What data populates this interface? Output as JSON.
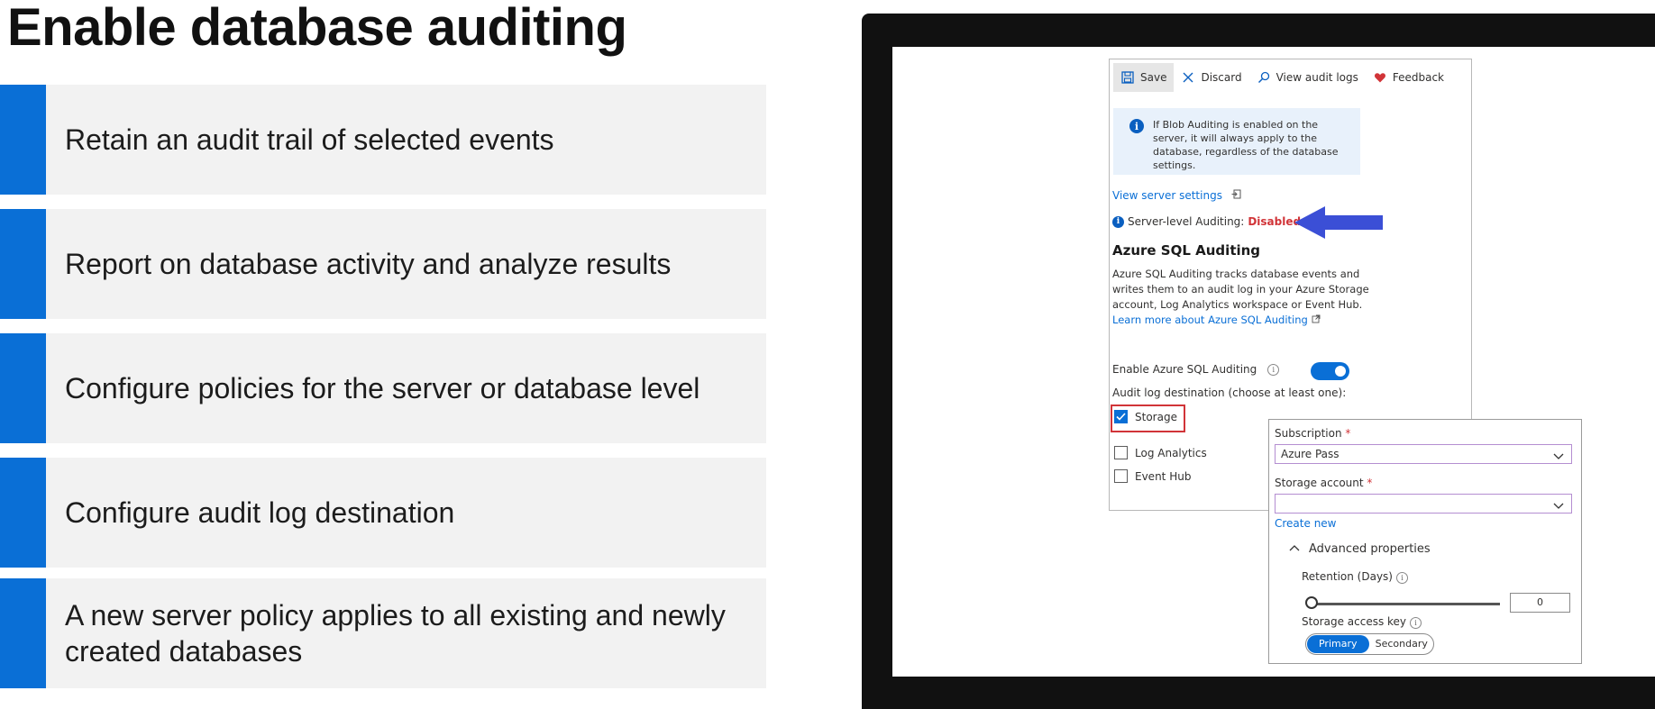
{
  "slide": {
    "title": "Enable database auditing",
    "bullets": [
      "Retain an audit trail of selected events",
      "Report on database activity and analyze results",
      "Configure policies for the server or database level",
      "Configure audit log destination",
      "A new server policy applies to all existing and newly created databases"
    ],
    "accent_color": "#0a6fd6"
  },
  "portal": {
    "toolbar": {
      "save": "Save",
      "discard": "Discard",
      "view_audit_logs": "View audit logs",
      "feedback": "Feedback"
    },
    "info_message": "If Blob Auditing is enabled on the server, it will always apply to the database, regardless of the database settings.",
    "view_server_settings": "View server settings",
    "server_level_label": "Server-level Auditing:",
    "server_level_status": "Disabled",
    "section_title": "Azure SQL Auditing",
    "description": "Azure SQL Auditing tracks database events and writes them to an audit log in your Azure Storage account, Log Analytics workspace or Event Hub.",
    "learn_more": "Learn more about Azure SQL Auditing",
    "enable_label": "Enable Azure SQL Auditing",
    "enable_on": true,
    "destination_label": "Audit log destination (choose at least one):",
    "destinations": [
      {
        "label": "Storage",
        "checked": true
      },
      {
        "label": "Log Analytics",
        "checked": false
      },
      {
        "label": "Event Hub",
        "checked": false
      }
    ],
    "storage_panel": {
      "subscription_label": "Subscription",
      "subscription_value": "Azure Pass",
      "storage_account_label": "Storage account",
      "storage_account_value": "",
      "create_new": "Create new",
      "advanced_properties": "Advanced properties",
      "retention_label": "Retention (Days)",
      "retention_value": "0",
      "access_key_label": "Storage access key",
      "access_key_options": [
        "Primary",
        "Secondary"
      ],
      "access_key_selected": "Primary"
    }
  }
}
